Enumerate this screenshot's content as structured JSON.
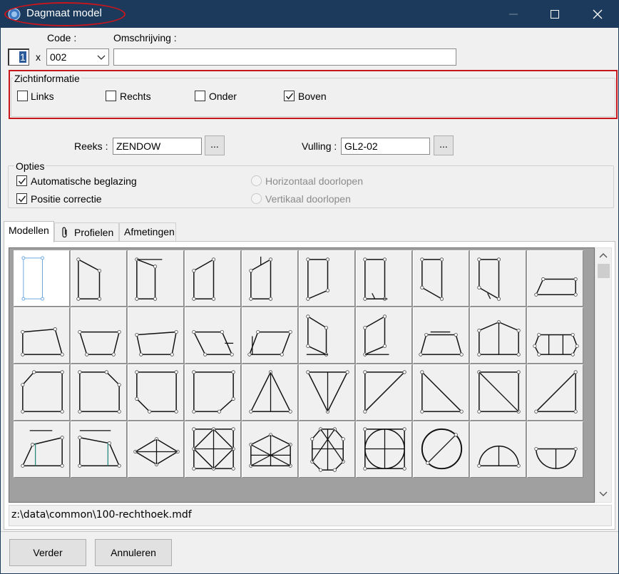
{
  "window": {
    "title": "Dagmaat model",
    "accent": "#1b3a5c",
    "highlight_color": "#c8161d",
    "controls": [
      "minimize-icon",
      "maximize-icon",
      "close-icon"
    ]
  },
  "header": {
    "code_label": "Code :",
    "description_label": "Omschrijving :",
    "count_value": "1",
    "multiply": "x",
    "code_value": "002",
    "description_value": ""
  },
  "view_info": {
    "title": "Zichtinformatie",
    "options": [
      {
        "label": "Links",
        "checked": false
      },
      {
        "label": "Rechts",
        "checked": false
      },
      {
        "label": "Onder",
        "checked": false
      },
      {
        "label": "Boven",
        "checked": true
      }
    ]
  },
  "series": {
    "label": "Reeks :",
    "value": "ZENDOW",
    "browse": "..."
  },
  "filling": {
    "label": "Vulling :",
    "value": "GL2-02",
    "browse": "..."
  },
  "options": {
    "title": "Opties",
    "automatic_glazing": {
      "label": "Automatische beglazing",
      "checked": true
    },
    "position_correction": {
      "label": "Positie correctie",
      "checked": true
    },
    "horizontal": {
      "label": "Horizontaal doorlopen",
      "enabled": false
    },
    "vertical": {
      "label": "Vertikaal doorlopen",
      "enabled": false
    }
  },
  "tabs": [
    {
      "label": "Modellen",
      "active": true
    },
    {
      "label": "Profielen",
      "active": false,
      "icon": "paperclip-icon"
    },
    {
      "label": "Afmetingen",
      "active": false
    }
  ],
  "status_path": "z:\\data\\common\\100-rechthoek.mdf",
  "buttons": {
    "next": "Verder",
    "cancel": "Annuleren"
  }
}
